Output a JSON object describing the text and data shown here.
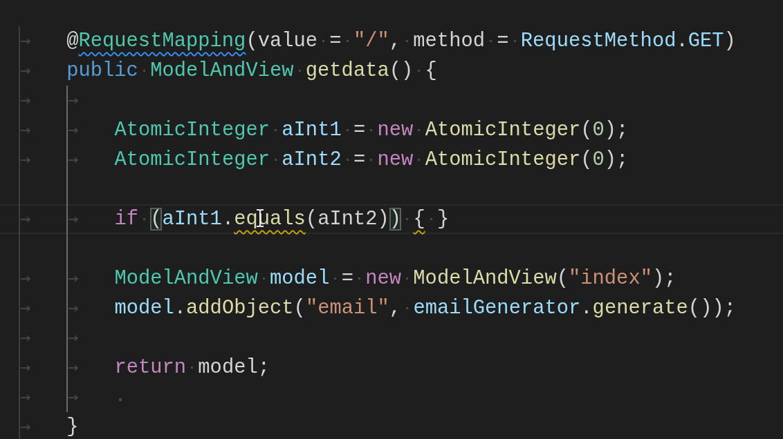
{
  "editor": {
    "lines": [
      {
        "kind": "code",
        "tokens": [
          {
            "text": "@",
            "kind": "punct"
          },
          {
            "text": "RequestMapping",
            "kind": "type",
            "info_squiggle": true
          },
          {
            "text": "(value = ",
            "kind": "punct"
          },
          {
            "text": "\"/\"",
            "kind": "string"
          },
          {
            "text": ", method = ",
            "kind": "punct"
          },
          {
            "text": "RequestMethod",
            "kind": "variable"
          },
          {
            "text": ".",
            "kind": "punct"
          },
          {
            "text": "GET",
            "kind": "variable"
          },
          {
            "text": ")",
            "kind": "punct"
          }
        ]
      },
      {
        "kind": "code",
        "tokens": [
          {
            "text": "public ",
            "kind": "keyword"
          },
          {
            "text": "ModelAndView ",
            "kind": "type"
          },
          {
            "text": "getdata",
            "kind": "function"
          },
          {
            "text": "() {",
            "kind": "punct"
          }
        ],
        "children": [
          {
            "kind": "tabs"
          },
          {
            "kind": "code",
            "tokens": [
              {
                "text": "AtomicInteger ",
                "kind": "type"
              },
              {
                "text": "aInt1",
                "kind": "variable"
              },
              {
                "text": " = ",
                "kind": "punct"
              },
              {
                "text": "new ",
                "kind": "control"
              },
              {
                "text": "AtomicInteger",
                "kind": "function"
              },
              {
                "text": "(",
                "kind": "punct"
              },
              {
                "text": "0",
                "kind": "number"
              },
              {
                "text": ");",
                "kind": "punct"
              }
            ]
          },
          {
            "kind": "code",
            "tokens": [
              {
                "text": "AtomicInteger ",
                "kind": "type"
              },
              {
                "text": "aInt2",
                "kind": "variable"
              },
              {
                "text": " = ",
                "kind": "punct"
              },
              {
                "text": "new ",
                "kind": "control"
              },
              {
                "text": "AtomicInteger",
                "kind": "function"
              },
              {
                "text": "(",
                "kind": "punct"
              },
              {
                "text": "0",
                "kind": "number"
              },
              {
                "text": ");",
                "kind": "punct"
              }
            ]
          },
          {
            "kind": "empty"
          },
          {
            "kind": "code",
            "current": true,
            "tokens": [
              {
                "text": "if ",
                "kind": "control"
              },
              {
                "text": "(",
                "kind": "punct",
                "bracket_match": true
              },
              {
                "text": "aInt1",
                "kind": "variable"
              },
              {
                "text": ".",
                "kind": "punct"
              },
              {
                "text": "equals",
                "kind": "function",
                "warning_squiggle": true
              },
              {
                "text": "(aInt2)",
                "kind": "punct"
              },
              {
                "text": ")",
                "kind": "punct",
                "bracket_match": true
              },
              {
                "text": " {",
                "kind": "punct",
                "warning_squiggle": true
              },
              {
                "text": " }",
                "kind": "punct"
              }
            ]
          },
          {
            "kind": "empty"
          },
          {
            "kind": "code",
            "tokens": [
              {
                "text": "ModelAndView ",
                "kind": "type"
              },
              {
                "text": "model",
                "kind": "variable"
              },
              {
                "text": " = ",
                "kind": "punct"
              },
              {
                "text": "new ",
                "kind": "control"
              },
              {
                "text": "ModelAndView",
                "kind": "function"
              },
              {
                "text": "(",
                "kind": "punct"
              },
              {
                "text": "\"index\"",
                "kind": "string"
              },
              {
                "text": ");",
                "kind": "punct"
              }
            ]
          },
          {
            "kind": "code",
            "tokens": [
              {
                "text": "model",
                "kind": "variable"
              },
              {
                "text": ".",
                "kind": "punct"
              },
              {
                "text": "addObject",
                "kind": "function"
              },
              {
                "text": "(",
                "kind": "punct"
              },
              {
                "text": "\"email\"",
                "kind": "string"
              },
              {
                "text": ", ",
                "kind": "punct"
              },
              {
                "text": "emailGenerator",
                "kind": "variable"
              },
              {
                "text": ".",
                "kind": "punct"
              },
              {
                "text": "generate",
                "kind": "function"
              },
              {
                "text": "());",
                "kind": "punct"
              }
            ]
          },
          {
            "kind": "tabs"
          },
          {
            "kind": "code",
            "tokens": [
              {
                "text": "return ",
                "kind": "control"
              },
              {
                "text": "model;",
                "kind": "punct"
              }
            ]
          },
          {
            "kind": "space"
          }
        ]
      },
      {
        "kind": "code",
        "tokens": [
          {
            "text": "}",
            "kind": "punct"
          }
        ]
      }
    ]
  }
}
